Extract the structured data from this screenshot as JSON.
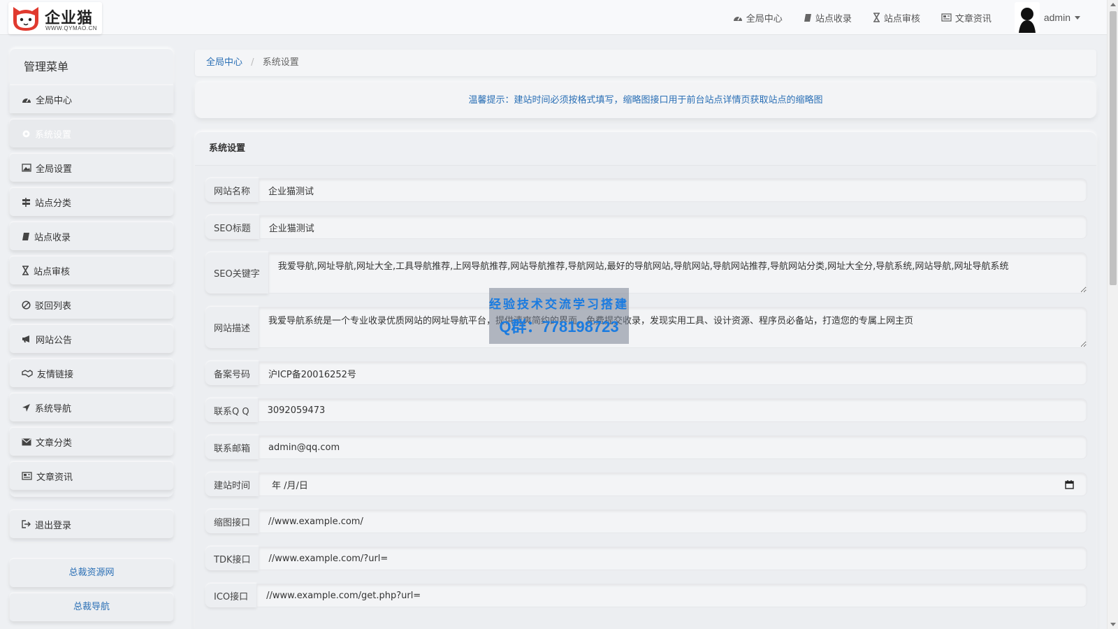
{
  "logo": {
    "name": "企业猫",
    "sub": "WWW.QYMAO.CN"
  },
  "topnav": [
    {
      "label": "全局中心",
      "icon": "dashboard-icon"
    },
    {
      "label": "站点收录",
      "icon": "book-icon"
    },
    {
      "label": "站点审核",
      "icon": "hourglass-icon"
    },
    {
      "label": "文章资讯",
      "icon": "newspaper-icon"
    }
  ],
  "user": {
    "name": "admin"
  },
  "sidebar": {
    "title": "管理菜单",
    "items": [
      {
        "label": "全局中心",
        "icon": "dashboard-icon"
      },
      {
        "label": "系统设置",
        "icon": "gear-icon",
        "active": true
      },
      {
        "label": "全局设置",
        "icon": "image-icon"
      },
      {
        "label": "站点分类",
        "icon": "signpost-icon"
      },
      {
        "label": "站点收录",
        "icon": "book-icon"
      },
      {
        "label": "站点审核",
        "icon": "hourglass-icon"
      },
      {
        "label": "驳回列表",
        "icon": "ban-icon"
      },
      {
        "label": "网站公告",
        "icon": "bullhorn-icon"
      },
      {
        "label": "友情链接",
        "icon": "handshake-icon"
      },
      {
        "label": "系统导航",
        "icon": "location-arrow-icon"
      },
      {
        "label": "文章分类",
        "icon": "envelope-icon"
      },
      {
        "label": "文章资讯",
        "icon": "newspaper-icon"
      }
    ],
    "logout": "退出登录",
    "links": [
      "总裁资源网",
      "总裁导航"
    ]
  },
  "breadcrumb": {
    "home": "全局中心",
    "current": "系统设置"
  },
  "notice": "温馨提示：建站时间必须按格式填写，缩略图接口用于前台站点详情页获取站点的缩略图",
  "panel": {
    "title": "系统设置"
  },
  "form": {
    "site_name": {
      "label": "网站名称",
      "value": "企业猫测试"
    },
    "seo_title": {
      "label": "SEO标题",
      "value": "企业猫测试"
    },
    "seo_keywords": {
      "label": "SEO关键字",
      "value": "我爱导航,网址导航,网址大全,工具导航推荐,上网导航推荐,网站导航推荐,导航网站,最好的导航网站,导航网站,导航网站推荐,导航网站分类,网址大全分,导航系统,网站导航,网址导航系统"
    },
    "site_desc": {
      "label": "网站描述",
      "value": "我爱导航系统是一个专业收录优质网站的网址导航平台，提供清爽简约的界面，免费提交收录，发现实用工具、设计资源、程序员必备站，打造您的专属上网主页"
    },
    "icp": {
      "label": "备案号码",
      "value": "沪ICP备20016252号"
    },
    "qq": {
      "label": "联系Q Q",
      "value": "3092059473"
    },
    "email": {
      "label": "联系邮箱",
      "value": "admin@qq.com"
    },
    "build_date": {
      "label": "建站时间",
      "value": "年 /月/日"
    },
    "thumb_api": {
      "label": "缩图接口",
      "value": "//www.example.com/"
    },
    "tdk_api": {
      "label": "TDK接口",
      "value": "//www.example.com/?url="
    },
    "ico_api": {
      "label": "ICO接口",
      "value": "//www.example.com/get.php?url="
    }
  },
  "watermark": {
    "line1": "经验技术交流学习搭建",
    "line2": "Q群：778198723"
  }
}
